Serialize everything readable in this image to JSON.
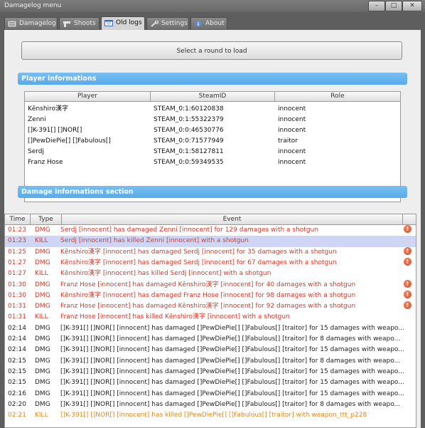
{
  "window": {
    "title": "Damagelog menu",
    "controls": [
      "–",
      "□",
      "✕"
    ]
  },
  "tabs": [
    {
      "label": "Damagelog",
      "icon": "list-icon",
      "active": false
    },
    {
      "label": "Shoots",
      "icon": "gun-icon",
      "active": false
    },
    {
      "label": "Old logs",
      "icon": "calendar-icon",
      "active": true
    },
    {
      "label": "Settings",
      "icon": "wrench-icon",
      "active": false
    },
    {
      "label": "About",
      "icon": "info-icon",
      "active": false
    }
  ],
  "load_button": "Select a round to load",
  "player_section": {
    "title": "Player informations",
    "columns": [
      "Player",
      "SteamID",
      "Role"
    ],
    "rows": [
      {
        "player": "Kēnshiro漢字",
        "steamid": "STEAM_0:1:60120838",
        "role": "innocent"
      },
      {
        "player": "Zenni",
        "steamid": "STEAM_0:1:55322379",
        "role": "innocent"
      },
      {
        "player": "[]K-391[] []NOR[]",
        "steamid": "STEAM_0:0:46530776",
        "role": "innocent"
      },
      {
        "player": "[]PewDiePie[] []Fabulous[]",
        "steamid": "STEAM_0:0:71577949",
        "role": "traitor"
      },
      {
        "player": "Serdj",
        "steamid": "STEAM_0:1:58127811",
        "role": "innocent"
      },
      {
        "player": "Franz Hose",
        "steamid": "STEAM_0:0:59349535",
        "role": "innocent"
      }
    ]
  },
  "damage_section": {
    "title": "Damage informations section",
    "columns": [
      "Time",
      "Type",
      "Event"
    ],
    "rows": [
      {
        "time": "01:23",
        "type": "DMG",
        "event": "Serdj [innocent] has damaged Zenni [innocent] for 129 damages with a shotgun",
        "color": "red",
        "warn": true,
        "selected": false
      },
      {
        "time": "01:23",
        "type": "KILL",
        "event": "Serdj [innocent] has killed Zenni [innocent] with a shotgun",
        "color": "red",
        "warn": false,
        "selected": true
      },
      {
        "time": "01:25",
        "type": "DMG",
        "event": "Kēnshiro漢字 [innocent] has damaged Serdj [innocent] for 35 damages with a shotgun",
        "color": "red",
        "warn": true,
        "selected": false
      },
      {
        "time": "01:27",
        "type": "DMG",
        "event": "Kēnshiro漢字 [innocent] has damaged Serdj [innocent] for 67 damages with a shotgun",
        "color": "red",
        "warn": true,
        "selected": false
      },
      {
        "time": "01:27",
        "type": "KILL",
        "event": "Kēnshiro漢字 [innocent] has killed Serdj [innocent] with a shotgun",
        "color": "red",
        "warn": false,
        "selected": false
      },
      {
        "time": "01:30",
        "type": "DMG",
        "event": "Franz Hose [innocent] has damaged Kēnshiro漢字 [innocent] for 40 damages with a shotgun",
        "color": "red",
        "warn": true,
        "selected": false
      },
      {
        "time": "01:30",
        "type": "DMG",
        "event": "Kēnshiro漢字 [innocent] has damaged Franz Hose [innocent] for 98 damages with a shotgun",
        "color": "red",
        "warn": true,
        "selected": false
      },
      {
        "time": "01:31",
        "type": "DMG",
        "event": "Franz Hose [innocent] has damaged Kēnshiro漢字 [innocent] for 92 damages with a shotgun",
        "color": "red",
        "warn": true,
        "selected": false
      },
      {
        "time": "01:31",
        "type": "KILL",
        "event": "Franz Hose [innocent] has killed Kēnshiro漢字 [innocent] with a shotgun",
        "color": "red",
        "warn": false,
        "selected": false
      },
      {
        "time": "02:14",
        "type": "DMG",
        "event": "[]K-391[] []NOR[] [innocent] has damaged []PewDiePie[] []Fabulous[] [traitor] for 15 damages with weapo...",
        "color": "dark",
        "warn": false,
        "selected": false
      },
      {
        "time": "02:14",
        "type": "DMG",
        "event": "[]K-391[] []NOR[] [innocent] has damaged []PewDiePie[] []Fabulous[] [traitor] for 8 damages with weapo...",
        "color": "dark",
        "warn": false,
        "selected": false
      },
      {
        "time": "02:14",
        "type": "DMG",
        "event": "[]K-391[] []NOR[] [innocent] has damaged []PewDiePie[] []Fabulous[] [traitor] for 15 damages with weapo...",
        "color": "dark",
        "warn": false,
        "selected": false
      },
      {
        "time": "02:15",
        "type": "DMG",
        "event": "[]K-391[] []NOR[] [innocent] has damaged []PewDiePie[] []Fabulous[] [traitor] for 8 damages with weapo...",
        "color": "dark",
        "warn": false,
        "selected": false
      },
      {
        "time": "02:15",
        "type": "DMG",
        "event": "[]K-391[] []NOR[] [innocent] has damaged []PewDiePie[] []Fabulous[] [traitor] for 15 damages with weapo...",
        "color": "dark",
        "warn": false,
        "selected": false
      },
      {
        "time": "02:15",
        "type": "DMG",
        "event": "[]K-391[] []NOR[] [innocent] has damaged []PewDiePie[] []Fabulous[] [traitor] for 15 damages with weapo...",
        "color": "dark",
        "warn": false,
        "selected": false
      },
      {
        "time": "02:16",
        "type": "DMG",
        "event": "[]K-391[] []NOR[] [innocent] has damaged []PewDiePie[] []Fabulous[] [traitor] for 15 damages with weapo...",
        "color": "dark",
        "warn": false,
        "selected": false
      },
      {
        "time": "02:20",
        "type": "DMG",
        "event": "[]K-391[] []NOR[] [innocent] has damaged []PewDiePie[] []Fabulous[] [traitor] for 8 damages with weapo...",
        "color": "dark",
        "warn": false,
        "selected": false
      },
      {
        "time": "02:21",
        "type": "KILL",
        "event": "[]K-391[] []NOR[] [innocent] has killed []PewDiePie[] []Fabulous[] [traitor] with weapon_ttt_p228",
        "color": "orange",
        "warn": false,
        "selected": false
      }
    ]
  },
  "colors": {
    "section_header": "#58aaea",
    "event_red": "#d43a2b",
    "event_orange": "#de8a1e",
    "selection": "#cfd6f5"
  }
}
